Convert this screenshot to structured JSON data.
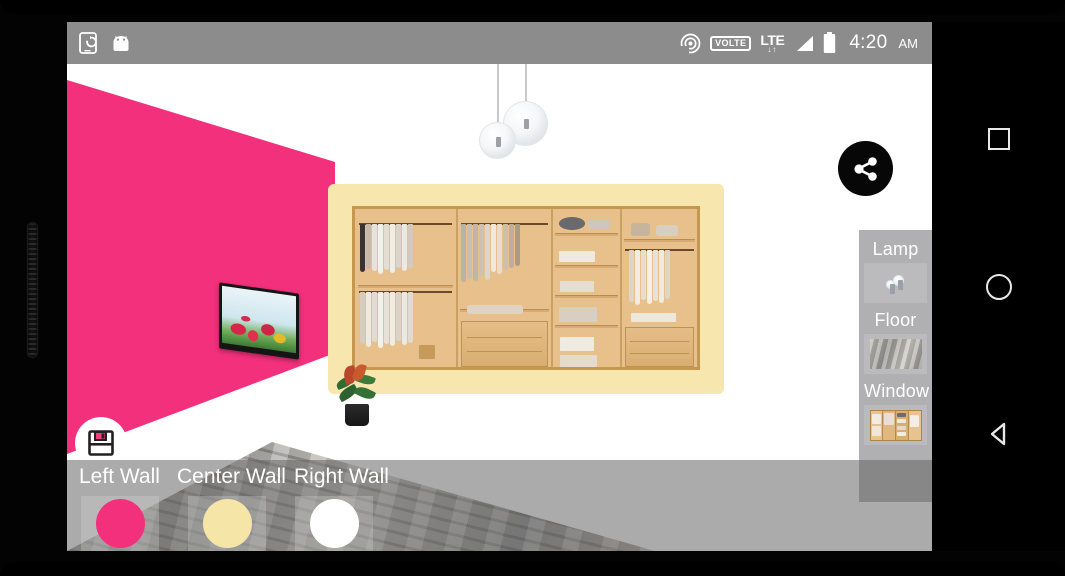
{
  "statusbar": {
    "left_icons": [
      {
        "name": "phone-sync-icon",
        "label": "sync"
      },
      {
        "name": "android-bot-icon",
        "label": "android"
      }
    ],
    "right_icons": [
      {
        "name": "wifi-calling-icon",
        "label": "wifi-calling"
      },
      {
        "name": "volte-icon",
        "label": "VOLTE"
      },
      {
        "name": "lte-signal-icon",
        "label": "LTE"
      },
      {
        "name": "signal-bars-icon",
        "label": "signal"
      },
      {
        "name": "battery-icon",
        "label": "battery"
      }
    ],
    "volte_label": "VOLTE",
    "lte_label": "LTE",
    "lte_arrows": "↓↑",
    "time": "4:20",
    "ampm": "AM"
  },
  "scene": {
    "left_wall_color": "#f2307c",
    "center_wall_color": "#f7e7ae",
    "right_wall_color": "#ffffff",
    "floor_name": "wood-plank-grey",
    "lamp_name": "pendant-glass-globes",
    "tv_name": "wall-tv-tulips",
    "wardrobe_name": "open-wardrobe-closet",
    "plant_name": "potted-plant"
  },
  "actions": {
    "share_label": "share",
    "save_label": "save"
  },
  "options_panel": {
    "items": [
      {
        "label": "Lamp",
        "thumb": "pendant-lamp-thumbnail"
      },
      {
        "label": "Floor",
        "thumb": "floor-texture-thumbnail"
      },
      {
        "label": "Window",
        "thumb": "wardrobe-thumbnail"
      }
    ]
  },
  "wall_selector": {
    "walls": [
      {
        "label": "Left Wall",
        "color": "#f2307c"
      },
      {
        "label": "Center Wall",
        "color": "#f5e6a8"
      },
      {
        "label": "Right Wall",
        "color": "#ffffff"
      }
    ]
  },
  "navbar": {
    "buttons": [
      {
        "name": "recents-button",
        "label": "Recents"
      },
      {
        "name": "home-button",
        "label": "Home"
      },
      {
        "name": "back-button",
        "label": "Back"
      }
    ]
  }
}
